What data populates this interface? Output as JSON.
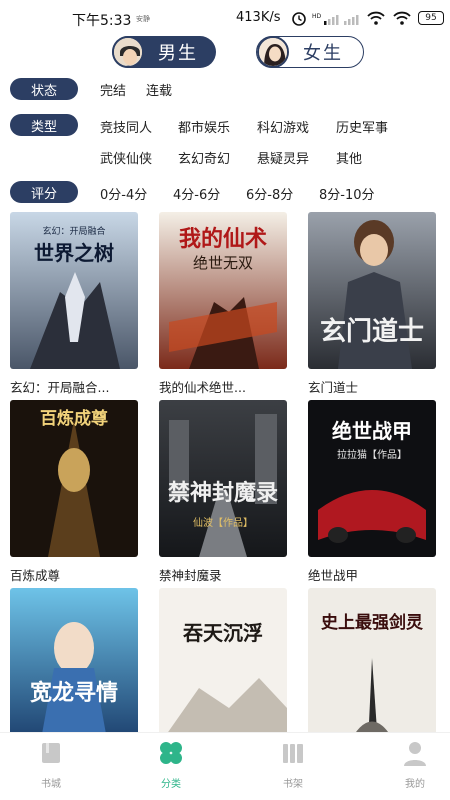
{
  "status_bar": {
    "time": "下午5:33",
    "mini_text": "安静",
    "network_speed": "413K/s",
    "battery": "95"
  },
  "gender_tabs": [
    {
      "label": "男生",
      "selected": true
    },
    {
      "label": "女生",
      "selected": false
    }
  ],
  "filters": {
    "status": {
      "tag": "状态",
      "options": [
        "完结",
        "连载"
      ]
    },
    "type": {
      "tag": "类型",
      "options_row1": [
        "竞技同人",
        "都市娱乐",
        "科幻游戏",
        "历史军事"
      ],
      "options_row2": [
        "武侠仙侠",
        "玄幻奇幻",
        "悬疑灵异",
        "其他"
      ]
    },
    "rating": {
      "tag": "评分",
      "options": [
        "0分-4分",
        "4分-6分",
        "6分-8分",
        "8分-10分"
      ]
    }
  },
  "books": [
    {
      "title": "玄幻：开局融合...",
      "cover_text": "世界之树",
      "cover_sub": "玄幻：开局融合"
    },
    {
      "title": "我的仙术绝世...",
      "cover_text": "我的仙术",
      "cover_sub": "绝世无双"
    },
    {
      "title": "玄门道士",
      "cover_text": "玄门道士",
      "cover_sub": ""
    },
    {
      "title": "百炼成尊",
      "cover_text": "百炼成尊",
      "cover_sub": ""
    },
    {
      "title": "禁神封魔录",
      "cover_text": "禁神封魔录",
      "cover_sub": "仙波【作品】"
    },
    {
      "title": "绝世战甲",
      "cover_text": "绝世战甲",
      "cover_sub": "拉拉猫【作品】"
    },
    {
      "title": "",
      "cover_text": "宽龙寻情",
      "cover_sub": ""
    },
    {
      "title": "",
      "cover_text": "吞天沉浮",
      "cover_sub": ""
    },
    {
      "title": "",
      "cover_text": "史上最强剑灵",
      "cover_sub": ""
    }
  ],
  "tab_bar": [
    {
      "label": "书城",
      "icon": "book-city-icon",
      "active": false
    },
    {
      "label": "分类",
      "icon": "clover-icon",
      "active": true
    },
    {
      "label": "书架",
      "icon": "bookshelf-icon",
      "active": false
    },
    {
      "label": "我的",
      "icon": "person-icon",
      "active": false
    }
  ],
  "colors": {
    "accent": "#2c3e63",
    "active_tab": "#2eb58a"
  }
}
